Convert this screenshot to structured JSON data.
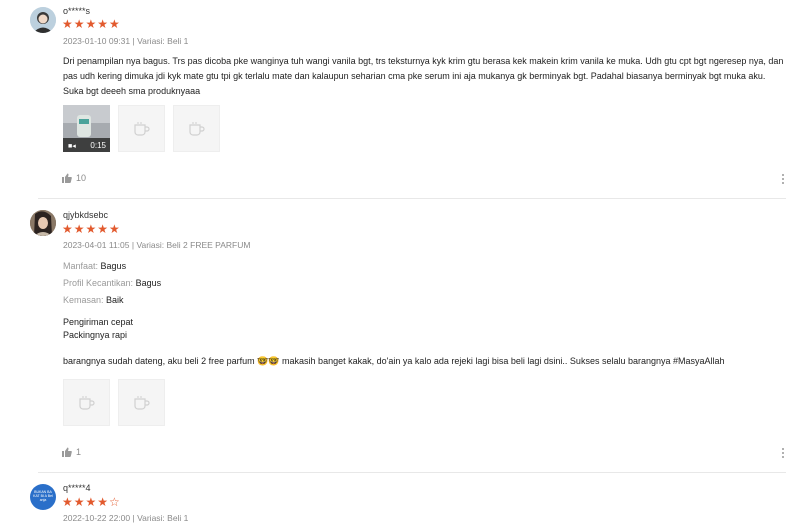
{
  "reviews": [
    {
      "username": "o*****s",
      "rating": 5,
      "date": "2023-01-10 09:31",
      "variant": "Variasi: Beli 1",
      "text": "Dri penampilan nya bagus. Trs pas dicoba pke wanginya tuh wangi vanila bgt, trs teksturnya kyk krim gtu berasa kek makein krim vanila ke muka. Udh gtu cpt bgt ngeresep nya, dan pas udh kering dimuka jdi kyk mate gtu tpi gk terlalu mate dan kalaupun seharian cma pke serum ini aja mukanya gk berminyak bgt. Padahal biasanya berminyak bgt muka aku. Suka bgt deeeh sma produknyaaa",
      "video_duration": "0:15",
      "likes": "10"
    },
    {
      "username": "qjybkdsebc",
      "rating": 5,
      "date": "2023-04-01 11:05",
      "variant": "Variasi: Beli 2 FREE PARFUM",
      "attributes": [
        {
          "key": "Manfaat:",
          "value": "Bagus"
        },
        {
          "key": "Profil Kecantikan:",
          "value": "Bagus"
        },
        {
          "key": "Kemasan:",
          "value": "Baik"
        }
      ],
      "lines": [
        "Pengiriman cepat",
        "Packingnya rapi"
      ],
      "text": "barangnya sudah dateng, aku beli 2 free parfum 🤓🤓 makasih banget kakak, do'ain ya kalo ada rejeki lagi bisa beli lagi dsini.. Sukses selalu barangnya #MasyaAllah",
      "likes": "1"
    },
    {
      "username": "q*****4",
      "rating": 4,
      "date": "2022-10-22 22:00",
      "variant": "Variasi: Beli 1",
      "avatar_text": "BUKAN BAKAT BI A Belanja"
    }
  ],
  "colors": {
    "star": "#e25a2e",
    "meta": "#8a8a8a",
    "placeholder_bg": "#f5f5f5"
  }
}
